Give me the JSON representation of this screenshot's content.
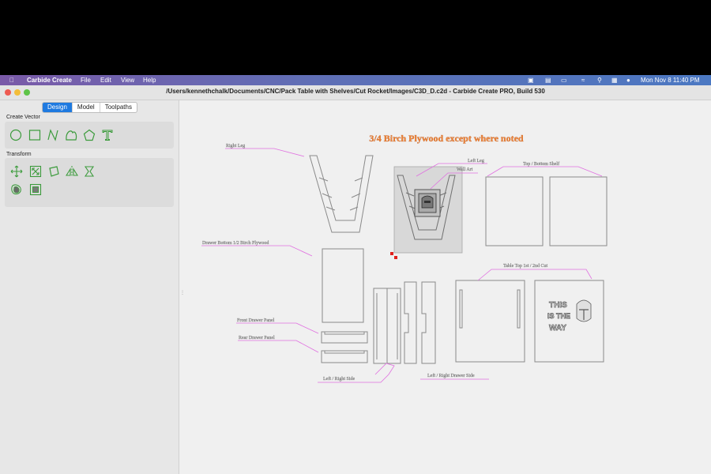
{
  "menubar": {
    "app_name": "Carbide Create",
    "items": [
      "File",
      "Edit",
      "View",
      "Help"
    ],
    "clock": "Mon Nov 8  11:40 PM"
  },
  "window": {
    "title": "/Users/kennethchalk/Documents/CNC/Pack Table with Shelves/Cut Rocket/Images/C3D_D.c2d - Carbide Create PRO, Build 530"
  },
  "sidebar": {
    "tabs": [
      {
        "label": "Design",
        "active": true
      },
      {
        "label": "Model",
        "active": false
      },
      {
        "label": "Toolpaths",
        "active": false
      }
    ],
    "create_vector_label": "Create Vector",
    "create_vector_tools": [
      "circle-icon",
      "rectangle-icon",
      "polyline-icon",
      "curve-icon",
      "polygon-icon",
      "text-icon"
    ],
    "transform_label": "Transform",
    "transform_tools": [
      "move-icon",
      "scale-icon",
      "rotate-icon",
      "mirror-icon",
      "align-icon",
      "offset-icon",
      "boolean-icon"
    ]
  },
  "canvas": {
    "heading": "3/4 Birch Plywood except where noted",
    "labels": {
      "right_leg": "Right Leg",
      "left_leg": "Left Leg",
      "wall_art": "Wall Art",
      "top_bottom_shelf": "Top / Bottom Shelf",
      "drawer_bottom": "Drawer Bottom  1/2 Birch Plywood",
      "table_top": "Table Top 1st / 2nd Cut",
      "front_drawer_panel": "Front Drawer Panel",
      "rear_drawer_panel": "Rear Drawer Panel",
      "left_right_side": "Left / Right Side",
      "left_right_drawer_side": "Left / Right Drawer Side"
    },
    "engraving_text": [
      "THIS",
      "IS THE",
      "WAY"
    ],
    "colors": {
      "heading": "#f0883a",
      "leader": "#e070e0",
      "part_outline": "#8a8a8a",
      "selection": "#d8d8d8",
      "accent": "#1f7ae0"
    }
  }
}
